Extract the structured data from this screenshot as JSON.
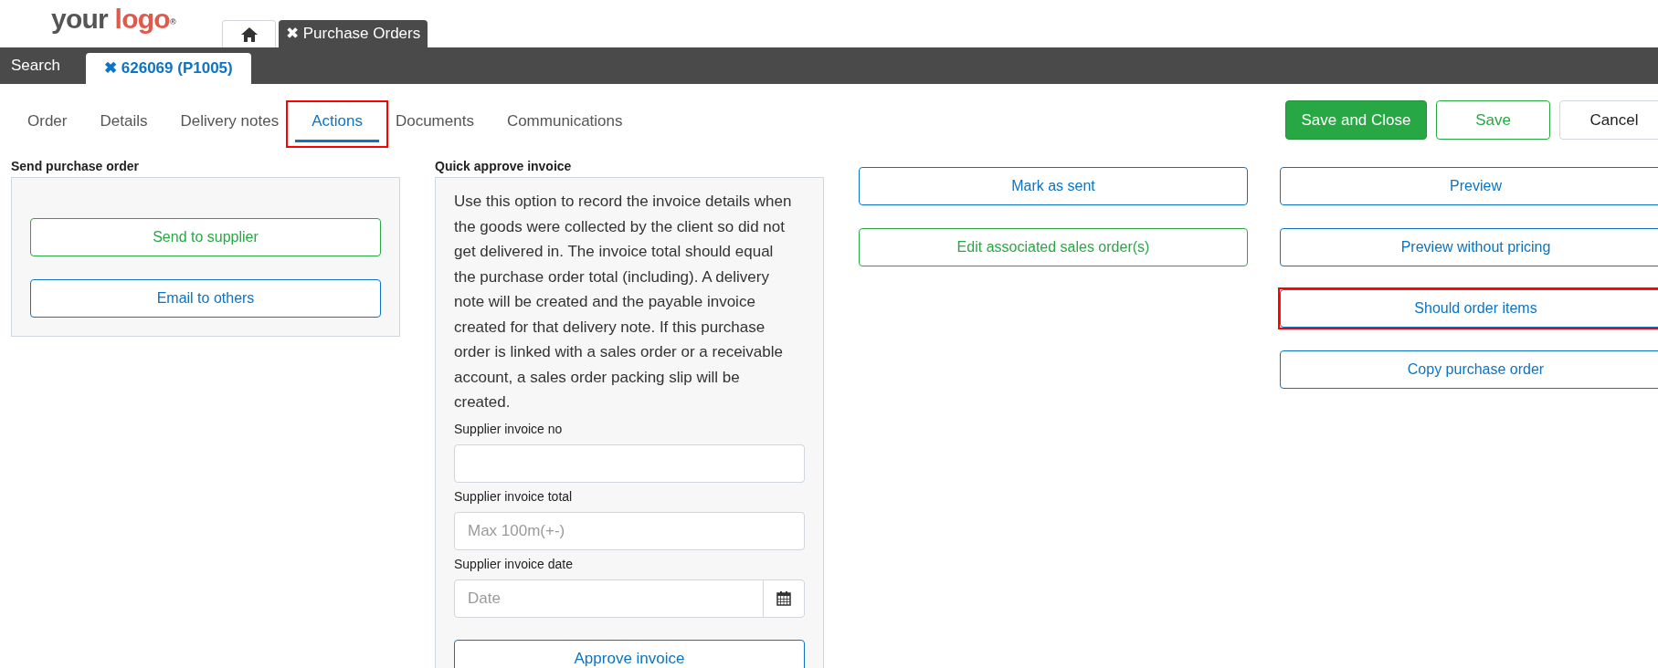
{
  "logo": {
    "first": "your",
    "second": "logo",
    "mark": "®"
  },
  "top_tabs": [
    {
      "kind": "home",
      "selected": false
    },
    {
      "kind": "text",
      "label": "✖ Purchase Orders",
      "selected": true
    }
  ],
  "record_bar": {
    "search": "Search",
    "tabs": [
      {
        "label": "✖ 626069 (P1005)",
        "selected": true
      }
    ]
  },
  "nav_tabs": [
    {
      "label": "Order",
      "selected": false,
      "highlighted": false
    },
    {
      "label": "Details",
      "selected": false,
      "highlighted": false
    },
    {
      "label": "Delivery notes",
      "selected": false,
      "highlighted": false
    },
    {
      "label": "Actions",
      "selected": true,
      "highlighted": true
    },
    {
      "label": "Documents",
      "selected": false,
      "highlighted": false
    },
    {
      "label": "Communications",
      "selected": false,
      "highlighted": false
    }
  ],
  "toolbar": [
    {
      "label": "Save and Close",
      "kind": "solid-green"
    },
    {
      "label": "Save",
      "kind": "outline-green"
    },
    {
      "label": "Cancel",
      "kind": "plain"
    }
  ],
  "send_purchase_order": {
    "title": "Send purchase order",
    "buttons": [
      {
        "label": "Send to supplier",
        "kind": "green",
        "highlighted": false
      },
      {
        "label": "Email to others",
        "kind": "blue",
        "highlighted": false
      }
    ]
  },
  "quick_approve": {
    "title": "Quick approve invoice",
    "description": "Use this option to record the invoice details when the goods were collected by the client so did not get delivered in. The invoice total should equal the purchase order total (including). A delivery note will be created and the payable invoice created for that delivery note. If this purchase order is linked with a sales order or a receivable account, a sales order packing slip will be created.",
    "fields": [
      {
        "label": "Supplier invoice no",
        "kind": "text"
      },
      {
        "label": "Supplier invoice total",
        "kind": "text",
        "placeholder": "Max 100m(+-)"
      },
      {
        "label": "Supplier invoice date",
        "kind": "date",
        "placeholder": "Date"
      }
    ],
    "button": "Approve invoice"
  },
  "actions_middle": [
    {
      "label": "Mark as sent",
      "kind": "blue",
      "highlighted": false
    },
    {
      "label": "Edit associated sales order(s)",
      "kind": "green",
      "highlighted": false
    }
  ],
  "actions_right": [
    {
      "label": "Preview",
      "kind": "blue",
      "highlighted": false
    },
    {
      "label": "Preview without pricing",
      "kind": "blue",
      "highlighted": false
    },
    {
      "label": "Should order items",
      "kind": "blue",
      "highlighted": true
    },
    {
      "label": "Copy purchase order",
      "kind": "blue",
      "highlighted": false
    }
  ]
}
